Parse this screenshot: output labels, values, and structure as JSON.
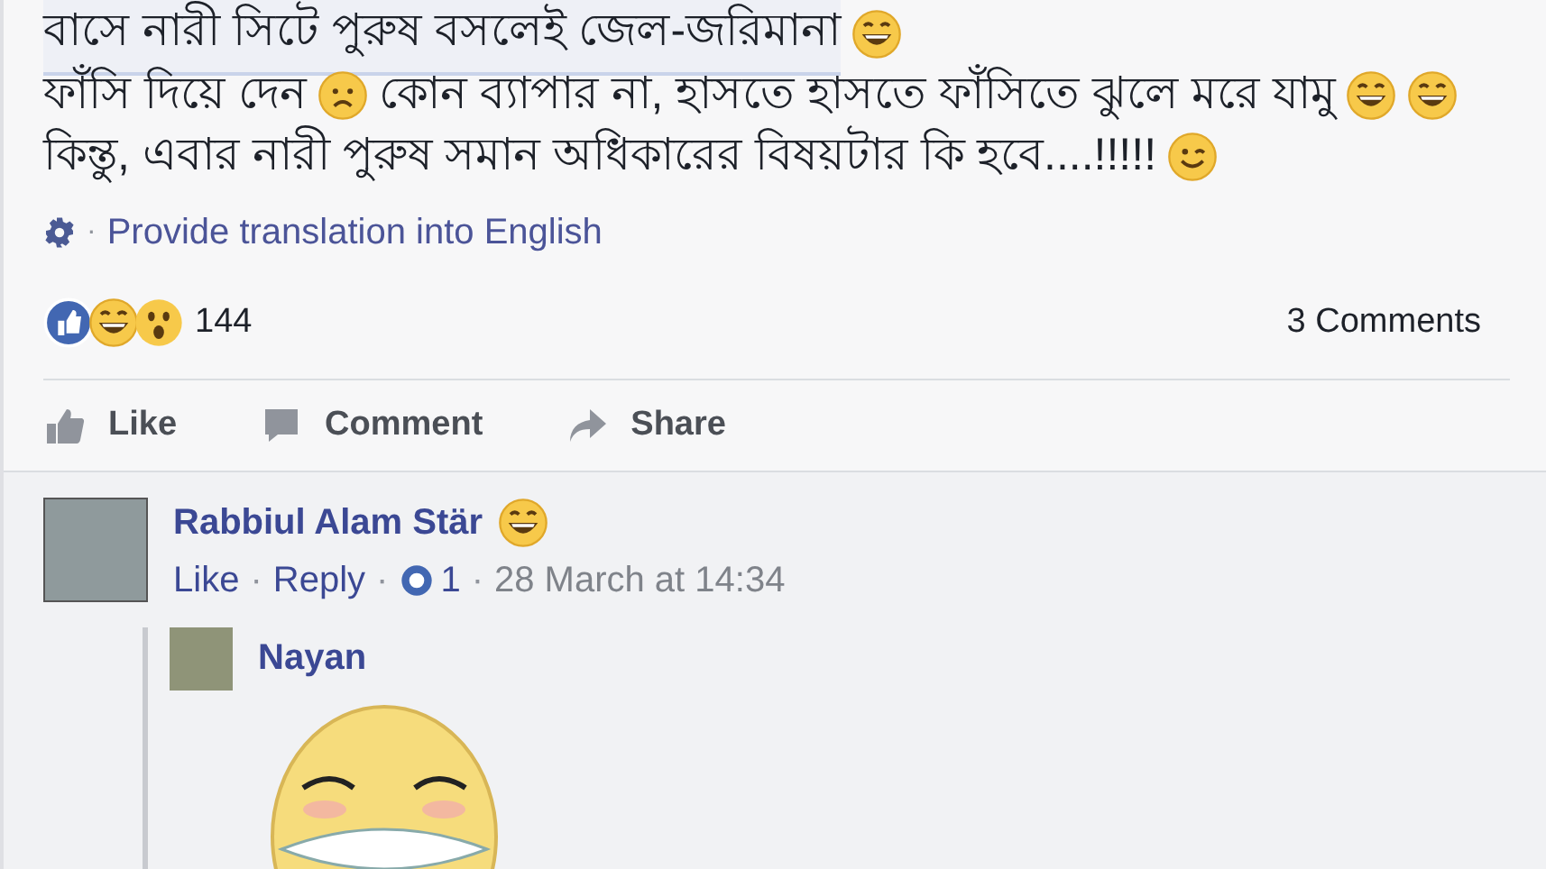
{
  "post": {
    "lines": [
      {
        "underlined": true,
        "segments": [
          {
            "kind": "text",
            "text": "বাসে নারী সিটে পুরুষ বসলেই জেল-জরিমানা"
          },
          {
            "kind": "grin-emoji"
          }
        ]
      },
      {
        "underlined": false,
        "segments": [
          {
            "kind": "text",
            "text": "ফাঁসি দিয়ে দেন"
          },
          {
            "kind": "sad-emoji"
          },
          {
            "kind": "text",
            "text": "কোন ব্যাপার না, হাসতে হাসতে ফাঁসিতে ঝুলে মরে যামু"
          },
          {
            "kind": "grin-emoji"
          },
          {
            "kind": "grin-emoji"
          }
        ]
      },
      {
        "underlined": false,
        "segments": [
          {
            "kind": "text",
            "text": "কিন্তু, এবার নারী পুরুষ সমান অধিকারের বিষয়টার কি হবে....!!!!!"
          },
          {
            "kind": "wink-emoji"
          }
        ]
      }
    ],
    "translation_separator": "·",
    "translation_link": "Provide translation into English",
    "reaction_count": "144",
    "comments_count": "3 Comments",
    "actions": [
      {
        "kind": "like",
        "label": "Like"
      },
      {
        "kind": "comment",
        "label": "Comment"
      },
      {
        "kind": "share",
        "label": "Share"
      }
    ]
  },
  "comments": [
    {
      "author": "Rabbiul Alam Stär",
      "meta_separator": "·",
      "meta": [
        {
          "kind": "link",
          "text": "Like"
        },
        {
          "kind": "link",
          "text": "Reply"
        },
        {
          "kind": "likes",
          "text": "1"
        },
        {
          "kind": "time",
          "text": "28 March at 14:34"
        }
      ],
      "replies": [
        {
          "author": "Nayan"
        }
      ]
    }
  ]
}
